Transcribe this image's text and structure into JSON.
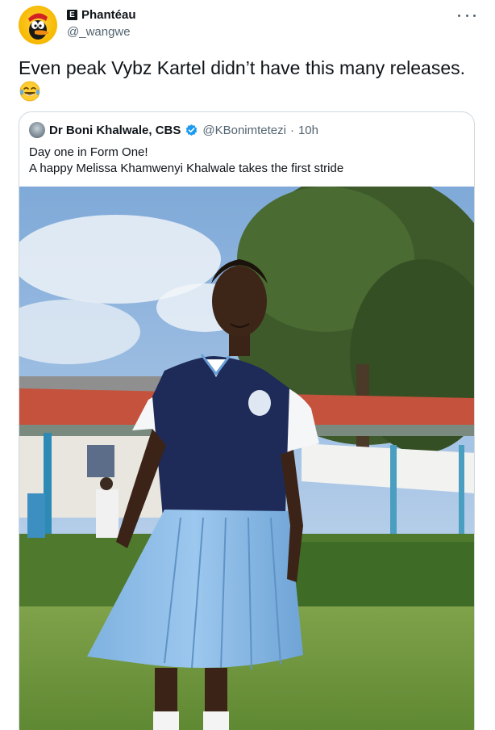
{
  "tweet": {
    "author": {
      "badge": "E",
      "display_name": "Phantéau",
      "handle": "@_wangwe",
      "avatar_icon": "cartoon-duck-avatar"
    },
    "more_icon": "more-horizontal-icon",
    "text": "Even peak Vybz Kartel didn’t have this many releases.",
    "emoji": "face-with-tears-of-joy-emoji"
  },
  "quote": {
    "display_name": "Dr Boni Khalwale, CBS",
    "verified": true,
    "verified_color": "#1d9bf0",
    "handle": "@KBonimtetezi",
    "separator": "·",
    "time": "10h",
    "lines": [
      "Day one in Form One!",
      "A happy Melissa Khamwenyi Khalwale takes the first stride"
    ],
    "photo_icon": "school-uniform-photo"
  },
  "colors": {
    "text": "#0f1419",
    "secondary": "#536471",
    "border": "#cfd9de",
    "accent": "#1d9bf0"
  }
}
